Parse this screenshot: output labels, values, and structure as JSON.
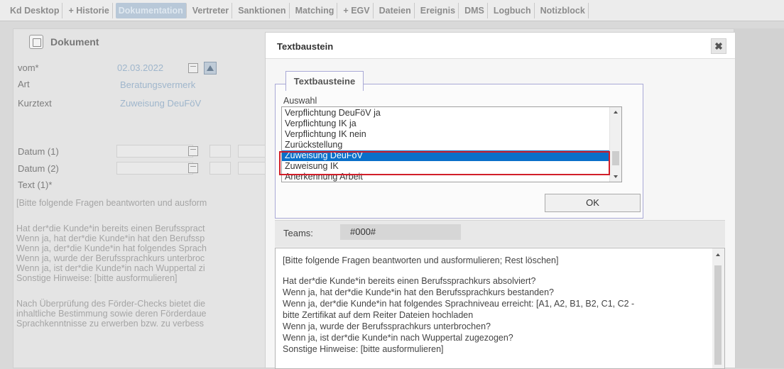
{
  "tabs": [
    "Kd Desktop",
    "+ Historie",
    "Dokumentation",
    "Vertreter",
    "Sanktionen",
    "Matching",
    "+ EGV",
    "Dateien",
    "Ereignis",
    "DMS",
    "Logbuch",
    "Notizblock"
  ],
  "active_tab": "Dokumentation",
  "document": {
    "title": "Dokument",
    "fields": {
      "vom_label": "vom*",
      "vom_value": "02.03.2022",
      "art_label": "Art",
      "art_value": "Beratungsvermerk",
      "kurztext_label": "Kurztext",
      "kurztext_value": "Zuweisung DeuFöV",
      "datum1_label": "Datum (1)",
      "datum2_label": "Datum (2)",
      "text1_label": "Text (1)*"
    },
    "text_lines": [
      "[Bitte folgende Fragen beantworten und ausform",
      "",
      "Hat der*die Kunde*in bereits einen Berufsspract",
      "Wenn ja, hat der*die Kunde*in hat den Berufssp",
      "Wenn ja, der*die Kunde*in hat folgendes Sprach",
      "Wenn ja, wurde der Berufssprachkurs unterbroc",
      "Wenn ja, ist der*die Kunde*in nach Wuppertal zi",
      "Sonstige Hinweise: [bitte ausformulieren]",
      "",
      "Nach Überprüfung des Förder-Checks bietet die",
      "inhaltliche Bestimmung sowie deren Förderdaue",
      "Sprachkenntnisse zu erwerben bzw. zu verbess"
    ]
  },
  "modal": {
    "title": "Textbaustein",
    "close_symbol": "✖",
    "tab_label": "Textbausteine",
    "auswahl_label": "Auswahl",
    "list_items": [
      "Verpflichtung DeuFöV ja",
      "Verpflichtung IK ja",
      "Verpflichtung IK nein",
      "Zurückstellung",
      "Zuweisung DeuFöV",
      "Zuweisung IK",
      "Anerkennung Arbeit"
    ],
    "selected_item": "Zuweisung DeuFöV",
    "ok_label": "OK",
    "teams_label": "Teams:",
    "teams_value": "#000#",
    "preview_lines": [
      "[Bitte folgende Fragen beantworten und ausformulieren; Rest löschen]",
      "",
      "Hat der*die Kunde*in bereits einen Berufssprachkurs absolviert?",
      "Wenn ja, hat der*die Kunde*in hat den Berufssprachkurs bestanden?",
      "Wenn ja, der*die Kunde*in hat folgendes Sprachniveau erreicht: [A1, A2, B1, B2, C1, C2 -",
      "bitte Zertifikat auf dem Reiter Dateien hochladen",
      "Wenn ja, wurde der Berufssprachkurs unterbrochen?",
      "Wenn ja, ist der*die Kunde*in nach Wuppertal zugezogen?",
      "Sonstige Hinweise: [bitte ausformulieren]"
    ]
  },
  "colors": {
    "selection": "#0a6fc9",
    "highlight_outline": "#d21f2a",
    "active_tab_bg": "#b8c8d8"
  }
}
